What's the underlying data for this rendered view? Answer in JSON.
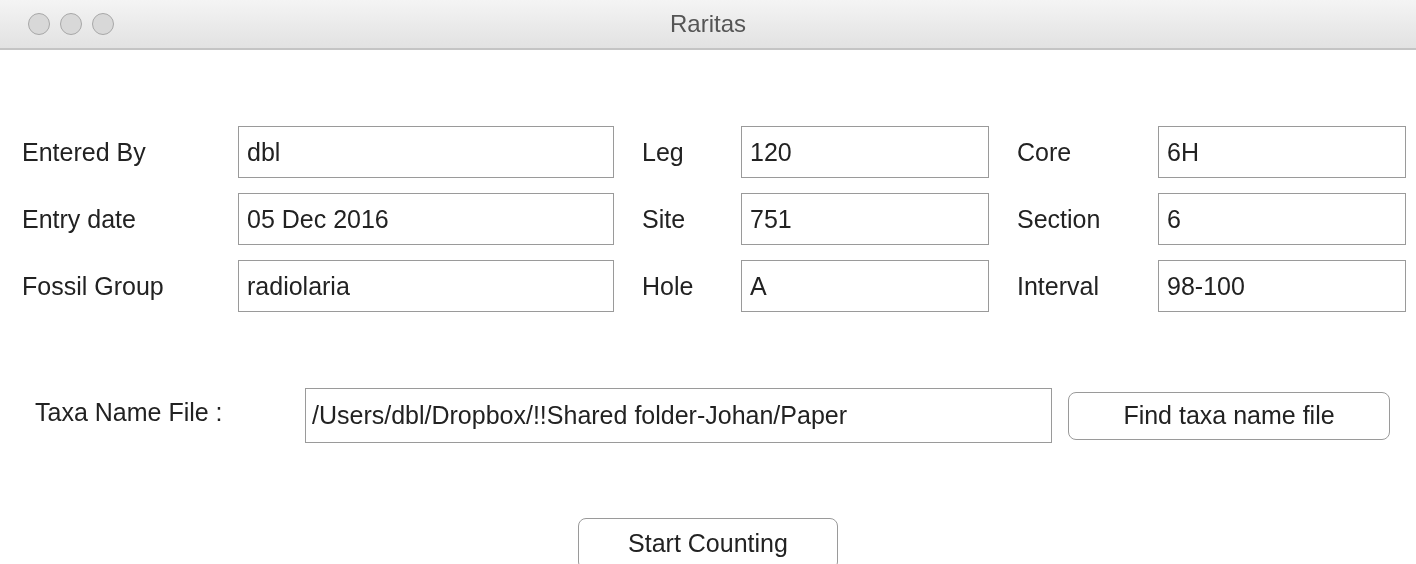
{
  "window": {
    "title": "Raritas"
  },
  "form_rows": [
    [
      {
        "label": "Entered By",
        "value": "dbl"
      },
      {
        "label": "Leg",
        "value": "120"
      },
      {
        "label": "Core",
        "value": "6H"
      }
    ],
    [
      {
        "label": "Entry date",
        "value": "05 Dec 2016"
      },
      {
        "label": "Site",
        "value": "751"
      },
      {
        "label": "Section",
        "value": "6"
      }
    ],
    [
      {
        "label": "Fossil Group",
        "value": "radiolaria"
      },
      {
        "label": "Hole",
        "value": "A"
      },
      {
        "label": "Interval",
        "value": "98-100"
      }
    ]
  ],
  "taxa_file": {
    "label": "Taxa Name File :",
    "value": "/Users/dbl/Dropbox/!!Shared folder-Johan/Paper",
    "button": "Find taxa name file"
  },
  "start_button": "Start Counting"
}
